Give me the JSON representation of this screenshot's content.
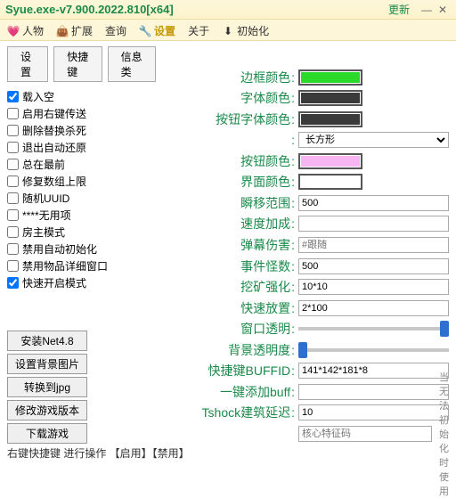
{
  "title": "Syue.exe-v7.900.2022.810[x64]",
  "update_label": "更新",
  "tabs": [
    {
      "label": "人物"
    },
    {
      "label": "扩展"
    },
    {
      "label": "查询"
    },
    {
      "label": "设置"
    },
    {
      "label": "关于"
    },
    {
      "label": "初始化"
    }
  ],
  "subtabs": {
    "settings": "设置",
    "hotkeys": "快捷键",
    "info": "信息类"
  },
  "checkboxes": [
    {
      "label": "载入空",
      "checked": true
    },
    {
      "label": "启用右键传送",
      "checked": false
    },
    {
      "label": "删除替换杀死",
      "checked": false
    },
    {
      "label": "退出自动还原",
      "checked": false
    },
    {
      "label": "总在最前",
      "checked": false
    },
    {
      "label": "修复数组上限",
      "checked": false
    },
    {
      "label": "随机UUID",
      "checked": false
    },
    {
      "label": "****无用项",
      "checked": false
    },
    {
      "label": "房主模式",
      "checked": false
    },
    {
      "label": "禁用自动初始化",
      "checked": false
    },
    {
      "label": "禁用物品详细窗口",
      "checked": false
    },
    {
      "label": "快速开启模式",
      "checked": true
    }
  ],
  "buttons": {
    "install_net": "安装Net4.8",
    "set_bg": "设置背景图片",
    "convert_jpg": "转换到jpg",
    "modify_ver": "修改游戏版本",
    "download": "下载游戏"
  },
  "fields": {
    "border_color": {
      "label": "边框颜色",
      "value": "#2bd92b"
    },
    "font_color": {
      "label": "字体颜色",
      "value": "#3a3a3a"
    },
    "btn_font_color": {
      "label": "按钮字体颜色",
      "value": "#3a3a3a"
    },
    "shape_select": {
      "value": "长方形"
    },
    "btn_color": {
      "label": "按钮颜色",
      "value": "#f7b6f2"
    },
    "ui_color": {
      "label": "界面颜色",
      "value": "#ffffff"
    },
    "tp_range": {
      "label": "瞬移范围",
      "value": "500"
    },
    "speed_bonus": {
      "label": "速度加成",
      "value": ""
    },
    "bullet_dmg": {
      "label": "弹幕伤害",
      "placeholder": "#跟随",
      "value": ""
    },
    "event_mobs": {
      "label": "事件怪数",
      "value": "500"
    },
    "mining": {
      "label": "挖矿强化",
      "value": "10*10"
    },
    "fast_place": {
      "label": "快速放置",
      "value": "2*100"
    },
    "window_opacity": {
      "label": "窗口透明",
      "slider": 100
    },
    "bg_opacity": {
      "label": "背景透明度",
      "slider": 0
    },
    "buffid": {
      "label": "快捷键BUFFID",
      "value": "141*142*181*8"
    },
    "one_key_buff": {
      "label": "一键添加buff",
      "value": ""
    },
    "tshock_delay": {
      "label": "Tshock建筑延迟",
      "value": "10"
    },
    "core_sig": {
      "label": "核心特征码",
      "hint": "当无法初始化时使用",
      "value": ""
    }
  },
  "footer": "右键快捷键 进行操作 【启用】【禁用】"
}
